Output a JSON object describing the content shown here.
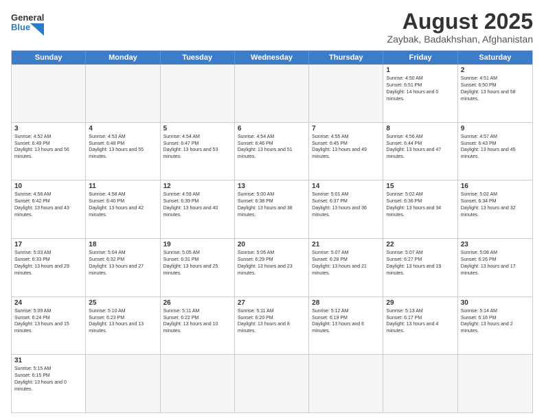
{
  "header": {
    "logo_general": "General",
    "logo_blue": "Blue",
    "month_year": "August 2025",
    "location": "Zaybak, Badakhshan, Afghanistan"
  },
  "days_of_week": [
    "Sunday",
    "Monday",
    "Tuesday",
    "Wednesday",
    "Thursday",
    "Friday",
    "Saturday"
  ],
  "weeks": [
    [
      {
        "day": "",
        "info": ""
      },
      {
        "day": "",
        "info": ""
      },
      {
        "day": "",
        "info": ""
      },
      {
        "day": "",
        "info": ""
      },
      {
        "day": "",
        "info": ""
      },
      {
        "day": "1",
        "info": "Sunrise: 4:50 AM\nSunset: 6:51 PM\nDaylight: 14 hours and 0 minutes."
      },
      {
        "day": "2",
        "info": "Sunrise: 4:51 AM\nSunset: 6:50 PM\nDaylight: 13 hours and 58 minutes."
      }
    ],
    [
      {
        "day": "3",
        "info": "Sunrise: 4:52 AM\nSunset: 6:49 PM\nDaylight: 13 hours and 56 minutes."
      },
      {
        "day": "4",
        "info": "Sunrise: 4:53 AM\nSunset: 6:48 PM\nDaylight: 13 hours and 55 minutes."
      },
      {
        "day": "5",
        "info": "Sunrise: 4:54 AM\nSunset: 6:47 PM\nDaylight: 13 hours and 53 minutes."
      },
      {
        "day": "6",
        "info": "Sunrise: 4:54 AM\nSunset: 6:46 PM\nDaylight: 13 hours and 51 minutes."
      },
      {
        "day": "7",
        "info": "Sunrise: 4:55 AM\nSunset: 6:45 PM\nDaylight: 13 hours and 49 minutes."
      },
      {
        "day": "8",
        "info": "Sunrise: 4:56 AM\nSunset: 6:44 PM\nDaylight: 13 hours and 47 minutes."
      },
      {
        "day": "9",
        "info": "Sunrise: 4:57 AM\nSunset: 6:43 PM\nDaylight: 13 hours and 45 minutes."
      }
    ],
    [
      {
        "day": "10",
        "info": "Sunrise: 4:58 AM\nSunset: 6:42 PM\nDaylight: 13 hours and 43 minutes."
      },
      {
        "day": "11",
        "info": "Sunrise: 4:58 AM\nSunset: 6:40 PM\nDaylight: 13 hours and 42 minutes."
      },
      {
        "day": "12",
        "info": "Sunrise: 4:59 AM\nSunset: 6:39 PM\nDaylight: 13 hours and 40 minutes."
      },
      {
        "day": "13",
        "info": "Sunrise: 5:00 AM\nSunset: 6:38 PM\nDaylight: 13 hours and 38 minutes."
      },
      {
        "day": "14",
        "info": "Sunrise: 5:01 AM\nSunset: 6:37 PM\nDaylight: 13 hours and 36 minutes."
      },
      {
        "day": "15",
        "info": "Sunrise: 5:02 AM\nSunset: 6:36 PM\nDaylight: 13 hours and 34 minutes."
      },
      {
        "day": "16",
        "info": "Sunrise: 5:02 AM\nSunset: 6:34 PM\nDaylight: 13 hours and 32 minutes."
      }
    ],
    [
      {
        "day": "17",
        "info": "Sunrise: 5:03 AM\nSunset: 6:33 PM\nDaylight: 13 hours and 29 minutes."
      },
      {
        "day": "18",
        "info": "Sunrise: 5:04 AM\nSunset: 6:32 PM\nDaylight: 13 hours and 27 minutes."
      },
      {
        "day": "19",
        "info": "Sunrise: 5:05 AM\nSunset: 6:31 PM\nDaylight: 13 hours and 25 minutes."
      },
      {
        "day": "20",
        "info": "Sunrise: 5:06 AM\nSunset: 6:29 PM\nDaylight: 13 hours and 23 minutes."
      },
      {
        "day": "21",
        "info": "Sunrise: 5:07 AM\nSunset: 6:28 PM\nDaylight: 13 hours and 21 minutes."
      },
      {
        "day": "22",
        "info": "Sunrise: 5:07 AM\nSunset: 6:27 PM\nDaylight: 13 hours and 19 minutes."
      },
      {
        "day": "23",
        "info": "Sunrise: 5:08 AM\nSunset: 6:26 PM\nDaylight: 13 hours and 17 minutes."
      }
    ],
    [
      {
        "day": "24",
        "info": "Sunrise: 5:09 AM\nSunset: 6:24 PM\nDaylight: 13 hours and 15 minutes."
      },
      {
        "day": "25",
        "info": "Sunrise: 5:10 AM\nSunset: 6:23 PM\nDaylight: 13 hours and 13 minutes."
      },
      {
        "day": "26",
        "info": "Sunrise: 5:11 AM\nSunset: 6:22 PM\nDaylight: 13 hours and 10 minutes."
      },
      {
        "day": "27",
        "info": "Sunrise: 5:11 AM\nSunset: 6:20 PM\nDaylight: 13 hours and 8 minutes."
      },
      {
        "day": "28",
        "info": "Sunrise: 5:12 AM\nSunset: 6:19 PM\nDaylight: 13 hours and 6 minutes."
      },
      {
        "day": "29",
        "info": "Sunrise: 5:13 AM\nSunset: 6:17 PM\nDaylight: 13 hours and 4 minutes."
      },
      {
        "day": "30",
        "info": "Sunrise: 5:14 AM\nSunset: 6:16 PM\nDaylight: 13 hours and 2 minutes."
      }
    ],
    [
      {
        "day": "31",
        "info": "Sunrise: 5:15 AM\nSunset: 6:15 PM\nDaylight: 13 hours and 0 minutes."
      },
      {
        "day": "",
        "info": ""
      },
      {
        "day": "",
        "info": ""
      },
      {
        "day": "",
        "info": ""
      },
      {
        "day": "",
        "info": ""
      },
      {
        "day": "",
        "info": ""
      },
      {
        "day": "",
        "info": ""
      }
    ]
  ]
}
